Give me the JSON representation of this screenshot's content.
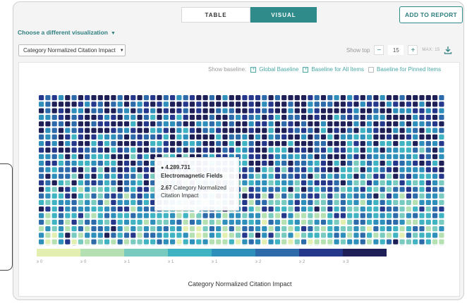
{
  "tabs": [
    {
      "label": "TABLE",
      "active": false
    },
    {
      "label": "VISUAL",
      "active": true
    }
  ],
  "add_to_report": "ADD TO REPORT",
  "choose_visualization": "Choose a different visualization",
  "metric_select": {
    "value": "Category Normalized Citation Impact"
  },
  "show_top": {
    "label": "Show top",
    "value": "15",
    "max": "MAX: 15",
    "minus": "−",
    "plus": "+"
  },
  "baseline": {
    "label": "Show baseline:",
    "items": [
      {
        "label": "Global Baseline",
        "checked": false
      },
      {
        "label": "Baseline for All Items",
        "checked": false
      },
      {
        "label": "Baseline for Pinned Items",
        "disabled": true
      }
    ]
  },
  "tooltip": {
    "title": "4.289.731 Electromagnetic Fields",
    "value": "2.67",
    "metric": "Category Normalized Citation Impact"
  },
  "chart_data": {
    "type": "heatmap",
    "xlabel": "Category Normalized Citation Impact",
    "legend": {
      "colors": [
        "#e3efb0",
        "#b5e0b2",
        "#79cbbf",
        "#3fb3c2",
        "#2e8fbb",
        "#2c6aaa",
        "#25378a",
        "#1d1f56"
      ],
      "labels": [
        "≥ 0",
        "≥ 0",
        "≥ 1",
        "≥ 1",
        "≥ 1",
        "≥ 2",
        "≥ 2",
        "≥ 3"
      ]
    },
    "grid": {
      "rows": 24,
      "cols": 62
    }
  },
  "colors": {
    "accent": "#2f8a8a",
    "tab_active": "#2f8a8a"
  },
  "icons": {
    "download": "download-icon",
    "caret": "chevron-down-icon"
  }
}
